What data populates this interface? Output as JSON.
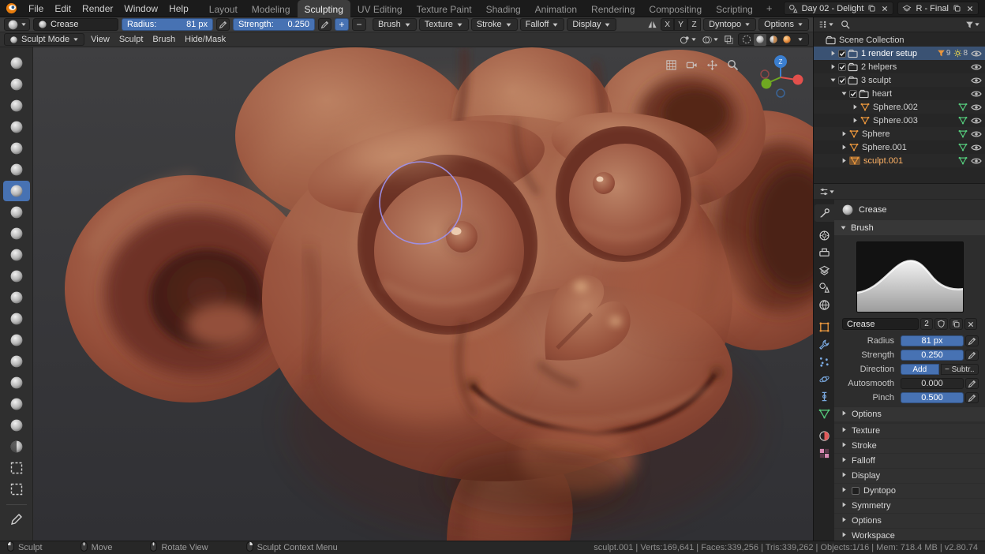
{
  "topbar": {
    "menus": [
      "File",
      "Edit",
      "Render",
      "Window",
      "Help"
    ],
    "tabs": [
      "Layout",
      "Modeling",
      "Sculpting",
      "UV Editing",
      "Texture Paint",
      "Shading",
      "Animation",
      "Rendering",
      "Compositing",
      "Scripting"
    ],
    "active_tab": "Sculpting",
    "add_tab": "+",
    "scene_name": "Day 02 - Delight",
    "view_layer_name": "R - Final"
  },
  "tool_header": {
    "brush_datablock": "Crease",
    "radius": {
      "label": "Radius:",
      "value": "81 px"
    },
    "strength": {
      "label": "Strength:",
      "value": "0.250"
    },
    "add": "+",
    "subtract": "−",
    "panels": [
      "Brush",
      "Texture",
      "Stroke",
      "Falloff",
      "Display"
    ],
    "mirror": [
      "X",
      "Y",
      "Z"
    ],
    "dyntopo": "Dyntopo",
    "options": "Options"
  },
  "viewport_header": {
    "mode": "Sculpt Mode",
    "menus": [
      "View",
      "Sculpt",
      "Brush",
      "Hide/Mask"
    ]
  },
  "toolbar": {
    "active": "Crease",
    "tools": [
      {
        "name": "Draw",
        "icon": "sphere"
      },
      {
        "name": "Clay",
        "icon": "sphere"
      },
      {
        "name": "Clay Strips",
        "icon": "sphere"
      },
      {
        "name": "Layer",
        "icon": "sphere"
      },
      {
        "name": "Inflate",
        "icon": "sphere"
      },
      {
        "name": "Blob",
        "icon": "sphere"
      },
      {
        "name": "Crease",
        "icon": "sphere"
      },
      {
        "name": "Smooth",
        "icon": "sphere"
      },
      {
        "name": "Flatten",
        "icon": "sphere"
      },
      {
        "name": "Fill",
        "icon": "sphere"
      },
      {
        "name": "Scrape",
        "icon": "sphere"
      },
      {
        "name": "Pinch",
        "icon": "sphere"
      },
      {
        "name": "Grab",
        "icon": "sphere"
      },
      {
        "name": "Snake Hook",
        "icon": "sphere"
      },
      {
        "name": "Thumb",
        "icon": "sphere"
      },
      {
        "name": "Nudge",
        "icon": "sphere"
      },
      {
        "name": "Rotate",
        "icon": "sphere"
      },
      {
        "name": "Simplify",
        "icon": "sphere"
      },
      {
        "name": "Mask",
        "icon": "sphere-dark"
      },
      {
        "name": "Box Mask",
        "icon": "box"
      },
      {
        "name": "Box Hide",
        "icon": "box"
      },
      {
        "name": "Annotate",
        "icon": "pencil",
        "separator_before": true
      }
    ]
  },
  "viewport": {
    "gizmo_axis_label": "Z",
    "axis_colors": {
      "x": "#e2504c",
      "y": "#6fa821",
      "z": "#3b7fd0"
    },
    "brush_cursor_color": "#9d90e8"
  },
  "outliner": {
    "rows": [
      {
        "label": "Scene Collection",
        "icon": "scene-collection",
        "indent": 0
      },
      {
        "label": "1 render setup",
        "icon": "collection",
        "indent": 1,
        "caret": "right",
        "checkbox": true,
        "selected": true,
        "eye": true,
        "badges": [
          {
            "icon": "mesh",
            "count": "9"
          },
          {
            "icon": "light",
            "count": "8"
          }
        ]
      },
      {
        "label": "2 helpers",
        "icon": "collection",
        "indent": 1,
        "caret": "right",
        "checkbox": true,
        "eye": true
      },
      {
        "label": "3 sculpt",
        "icon": "collection",
        "indent": 1,
        "caret": "down",
        "checkbox": true,
        "eye": true
      },
      {
        "label": "heart",
        "icon": "collection",
        "indent": 2,
        "caret": "down",
        "checkbox": true,
        "eye": true
      },
      {
        "label": "Sphere.002",
        "icon": "mesh",
        "indent": 3,
        "caret": "right",
        "data_icon": true,
        "eye": true
      },
      {
        "label": "Sphere.003",
        "icon": "mesh",
        "indent": 3,
        "caret": "right",
        "data_icon": true,
        "eye": true
      },
      {
        "label": "Sphere",
        "icon": "mesh",
        "indent": 2,
        "caret": "right",
        "data_icon": true,
        "eye": true
      },
      {
        "label": "Sphere.001",
        "icon": "mesh",
        "indent": 2,
        "caret": "right",
        "data_icon": true,
        "eye": true
      },
      {
        "label": "sculpt.001",
        "icon": "mesh",
        "indent": 2,
        "caret": "right",
        "active": true,
        "data_icon": true,
        "eye": true
      }
    ]
  },
  "properties": {
    "tabs": [
      {
        "name": "Active Tool",
        "icon": "tool",
        "active": true
      },
      {
        "name": "Render",
        "icon": "render"
      },
      {
        "name": "Output",
        "icon": "output"
      },
      {
        "name": "View Layer",
        "icon": "view-layer"
      },
      {
        "name": "Scene",
        "icon": "scene"
      },
      {
        "name": "World",
        "icon": "world"
      },
      {
        "name": "Object",
        "icon": "object"
      },
      {
        "name": "Modifiers",
        "icon": "modifiers"
      },
      {
        "name": "Particles",
        "icon": "particles"
      },
      {
        "name": "Physics",
        "icon": "physics"
      },
      {
        "name": "Constraints",
        "icon": "constraints"
      },
      {
        "name": "Object Data",
        "icon": "data"
      },
      {
        "name": "Material",
        "icon": "material"
      },
      {
        "name": "Texture",
        "icon": "texture"
      }
    ],
    "active_tool": {
      "name": "Crease"
    },
    "brush_panel_label": "Brush",
    "brush_name": "Crease",
    "users_count": "2",
    "fields": [
      {
        "label": "Radius",
        "value": "81 px",
        "widget": "slider",
        "filled": true,
        "pressure": true
      },
      {
        "label": "Strength",
        "value": "0.250",
        "widget": "slider",
        "filled": true,
        "pressure": true
      },
      {
        "label": "Direction",
        "widget": "toggles",
        "options": [
          "Add",
          "− Subtr.."
        ],
        "active_index": 0
      },
      {
        "label": "Autosmooth",
        "value": "0.000",
        "widget": "slider",
        "filled": false,
        "pressure": true
      },
      {
        "label": "Pinch",
        "value": "0.500",
        "widget": "slider",
        "filled": true,
        "pressure": true
      }
    ],
    "subsections": [
      {
        "label": "Options"
      }
    ],
    "sections": [
      {
        "label": "Texture"
      },
      {
        "label": "Stroke"
      },
      {
        "label": "Falloff"
      },
      {
        "label": "Display"
      },
      {
        "label": "Dyntopo",
        "checkbox": true
      },
      {
        "label": "Symmetry"
      },
      {
        "label": "Options"
      },
      {
        "label": "Workspace"
      }
    ]
  },
  "statusbar": {
    "hints": [
      {
        "button": "lmb",
        "label": "Sculpt"
      },
      {
        "button": "mmb",
        "label": "Move"
      },
      {
        "button": "mmb",
        "label": "Rotate View"
      },
      {
        "button": "rmb",
        "label": "Sculpt Context Menu"
      }
    ],
    "stats": "sculpt.001 | Verts:169,641 | Faces:339,256 | Tris:339,262 | Objects:1/16 | Mem: 718.4 MB | v2.80.74"
  }
}
